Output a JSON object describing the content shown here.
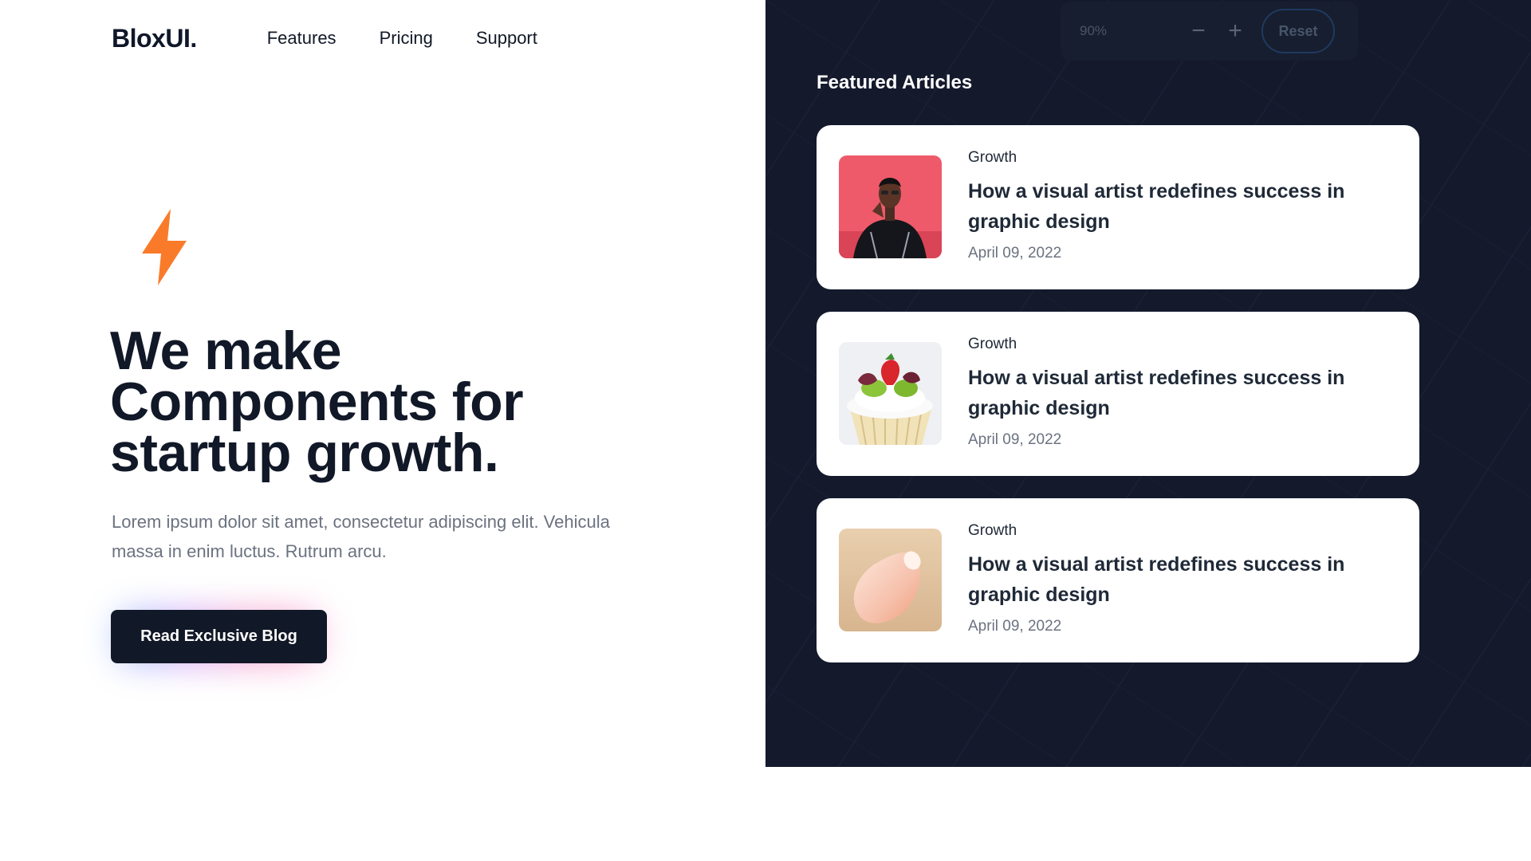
{
  "brand": {
    "logo": "BloxUI."
  },
  "nav": {
    "items": [
      "Features",
      "Pricing",
      "Support"
    ]
  },
  "hero": {
    "bolt_icon": "lightning-bolt-icon",
    "bolt_color": "#f97b2a",
    "headline_line1": "We make",
    "headline_line2": "Components for",
    "headline_line3": "startup growth.",
    "description": "Lorem ipsum dolor sit amet, consectetur adipiscing elit. Vehicula massa in enim luctus. Rutrum arcu.",
    "cta_label": "Read Exclusive Blog"
  },
  "zoom": {
    "value": "90%",
    "minus_icon": "minus-icon",
    "plus_icon": "plus-icon",
    "reset_label": "Reset"
  },
  "featured": {
    "title": "Featured Articles",
    "articles": [
      {
        "category": "Growth",
        "title": "How a visual artist redefines success in graphic design",
        "date": "April 09, 2022",
        "image": "portrait-man-pink-background"
      },
      {
        "category": "Growth",
        "title": "How a visual artist redefines success in graphic design",
        "date": "April 09, 2022",
        "image": "cupcake-with-strawberry"
      },
      {
        "category": "Growth",
        "title": "How a visual artist redefines success in graphic design",
        "date": "April 09, 2022",
        "image": "peach-vase-object"
      }
    ]
  },
  "colors": {
    "dark_panel": "#141a2c",
    "text_dark": "#111827",
    "muted": "#6b7280",
    "accent": "#f97b2a"
  }
}
